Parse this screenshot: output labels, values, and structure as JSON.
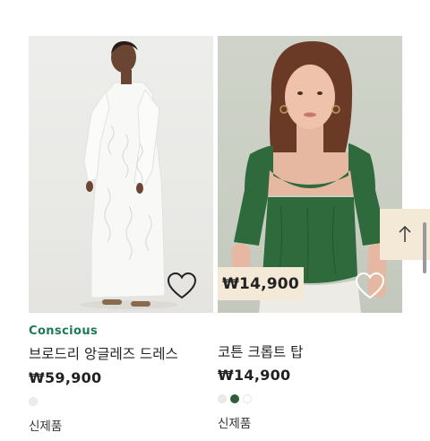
{
  "products": [
    {
      "marker": "Conscious",
      "title": "브로드리 앙글레즈 드레스",
      "price": "₩59,900",
      "badge": "신제품",
      "swatches": [
        "#f2ece2"
      ],
      "favorite_icon": "heart-outline-icon",
      "image_alt": "white broderie anglaise dress"
    },
    {
      "marker": "",
      "title": "코튼 크롭트 탑",
      "price": "₩14,900",
      "price_tag": "₩14,900",
      "badge": "신제품",
      "swatches": [
        "#efe9e2",
        "#2e5e3c",
        "#ffffff"
      ],
      "favorite_icon": "heart-outline-icon",
      "image_alt": "green cotton cropped top"
    }
  ],
  "scroll_top_icon": "arrow-up-icon",
  "colors": {
    "conscious_green": "#1d7a57",
    "tag_bg": "#f4e8d6"
  }
}
